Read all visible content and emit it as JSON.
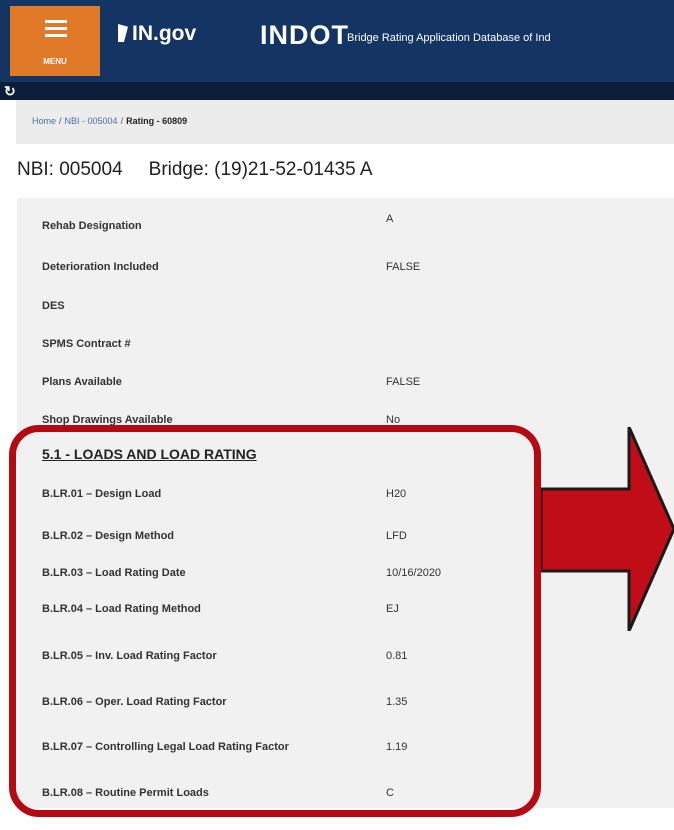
{
  "header": {
    "menu_label": "MENU",
    "in_gov": "IN.gov",
    "indot": "INDOT",
    "app_title": "Bridge Rating Application Database of Ind"
  },
  "breadcrumb": {
    "home": "Home",
    "nbi": "NBI - 005004",
    "rating": "Rating - 60809"
  },
  "title": {
    "nbi": "NBI: 005004",
    "bridge": "Bridge: (19)21-52-01435 A"
  },
  "details": [
    {
      "label": "Rehab Designation",
      "value": "A"
    },
    {
      "label": "Deterioration Included",
      "value": "FALSE"
    },
    {
      "label": "DES",
      "value": ""
    },
    {
      "label": "SPMS Contract #",
      "value": ""
    },
    {
      "label": "Plans Available",
      "value": "FALSE"
    },
    {
      "label": "Shop Drawings Available",
      "value": "No"
    }
  ],
  "section": {
    "title": "5.1 - LOADS AND LOAD RATING",
    "rows": [
      {
        "label": "B.LR.01 – Design Load",
        "value": "H20"
      },
      {
        "label": "B.LR.02 – Design Method",
        "value": "LFD"
      },
      {
        "label": "B.LR.03 – Load Rating Date",
        "value": "10/16/2020"
      },
      {
        "label": "B.LR.04 – Load Rating Method",
        "value": "EJ"
      },
      {
        "label": "B.LR.05 – Inv. Load Rating Factor",
        "value": "0.81"
      },
      {
        "label": "B.LR.06 – Oper. Load Rating Factor",
        "value": "1.35"
      },
      {
        "label": "B.LR.07 – Controlling Legal Load Rating Factor",
        "value": "1.19"
      },
      {
        "label": "B.LR.08 – Routine Permit Loads",
        "value": "C"
      }
    ]
  },
  "colors": {
    "header_bg": "#143464",
    "menu_bg": "#e07a29",
    "highlight": "#b40a14"
  },
  "icons": {
    "menu": "hamburger-icon",
    "refresh": "refresh-icon",
    "arrow": "right-arrow-icon"
  }
}
